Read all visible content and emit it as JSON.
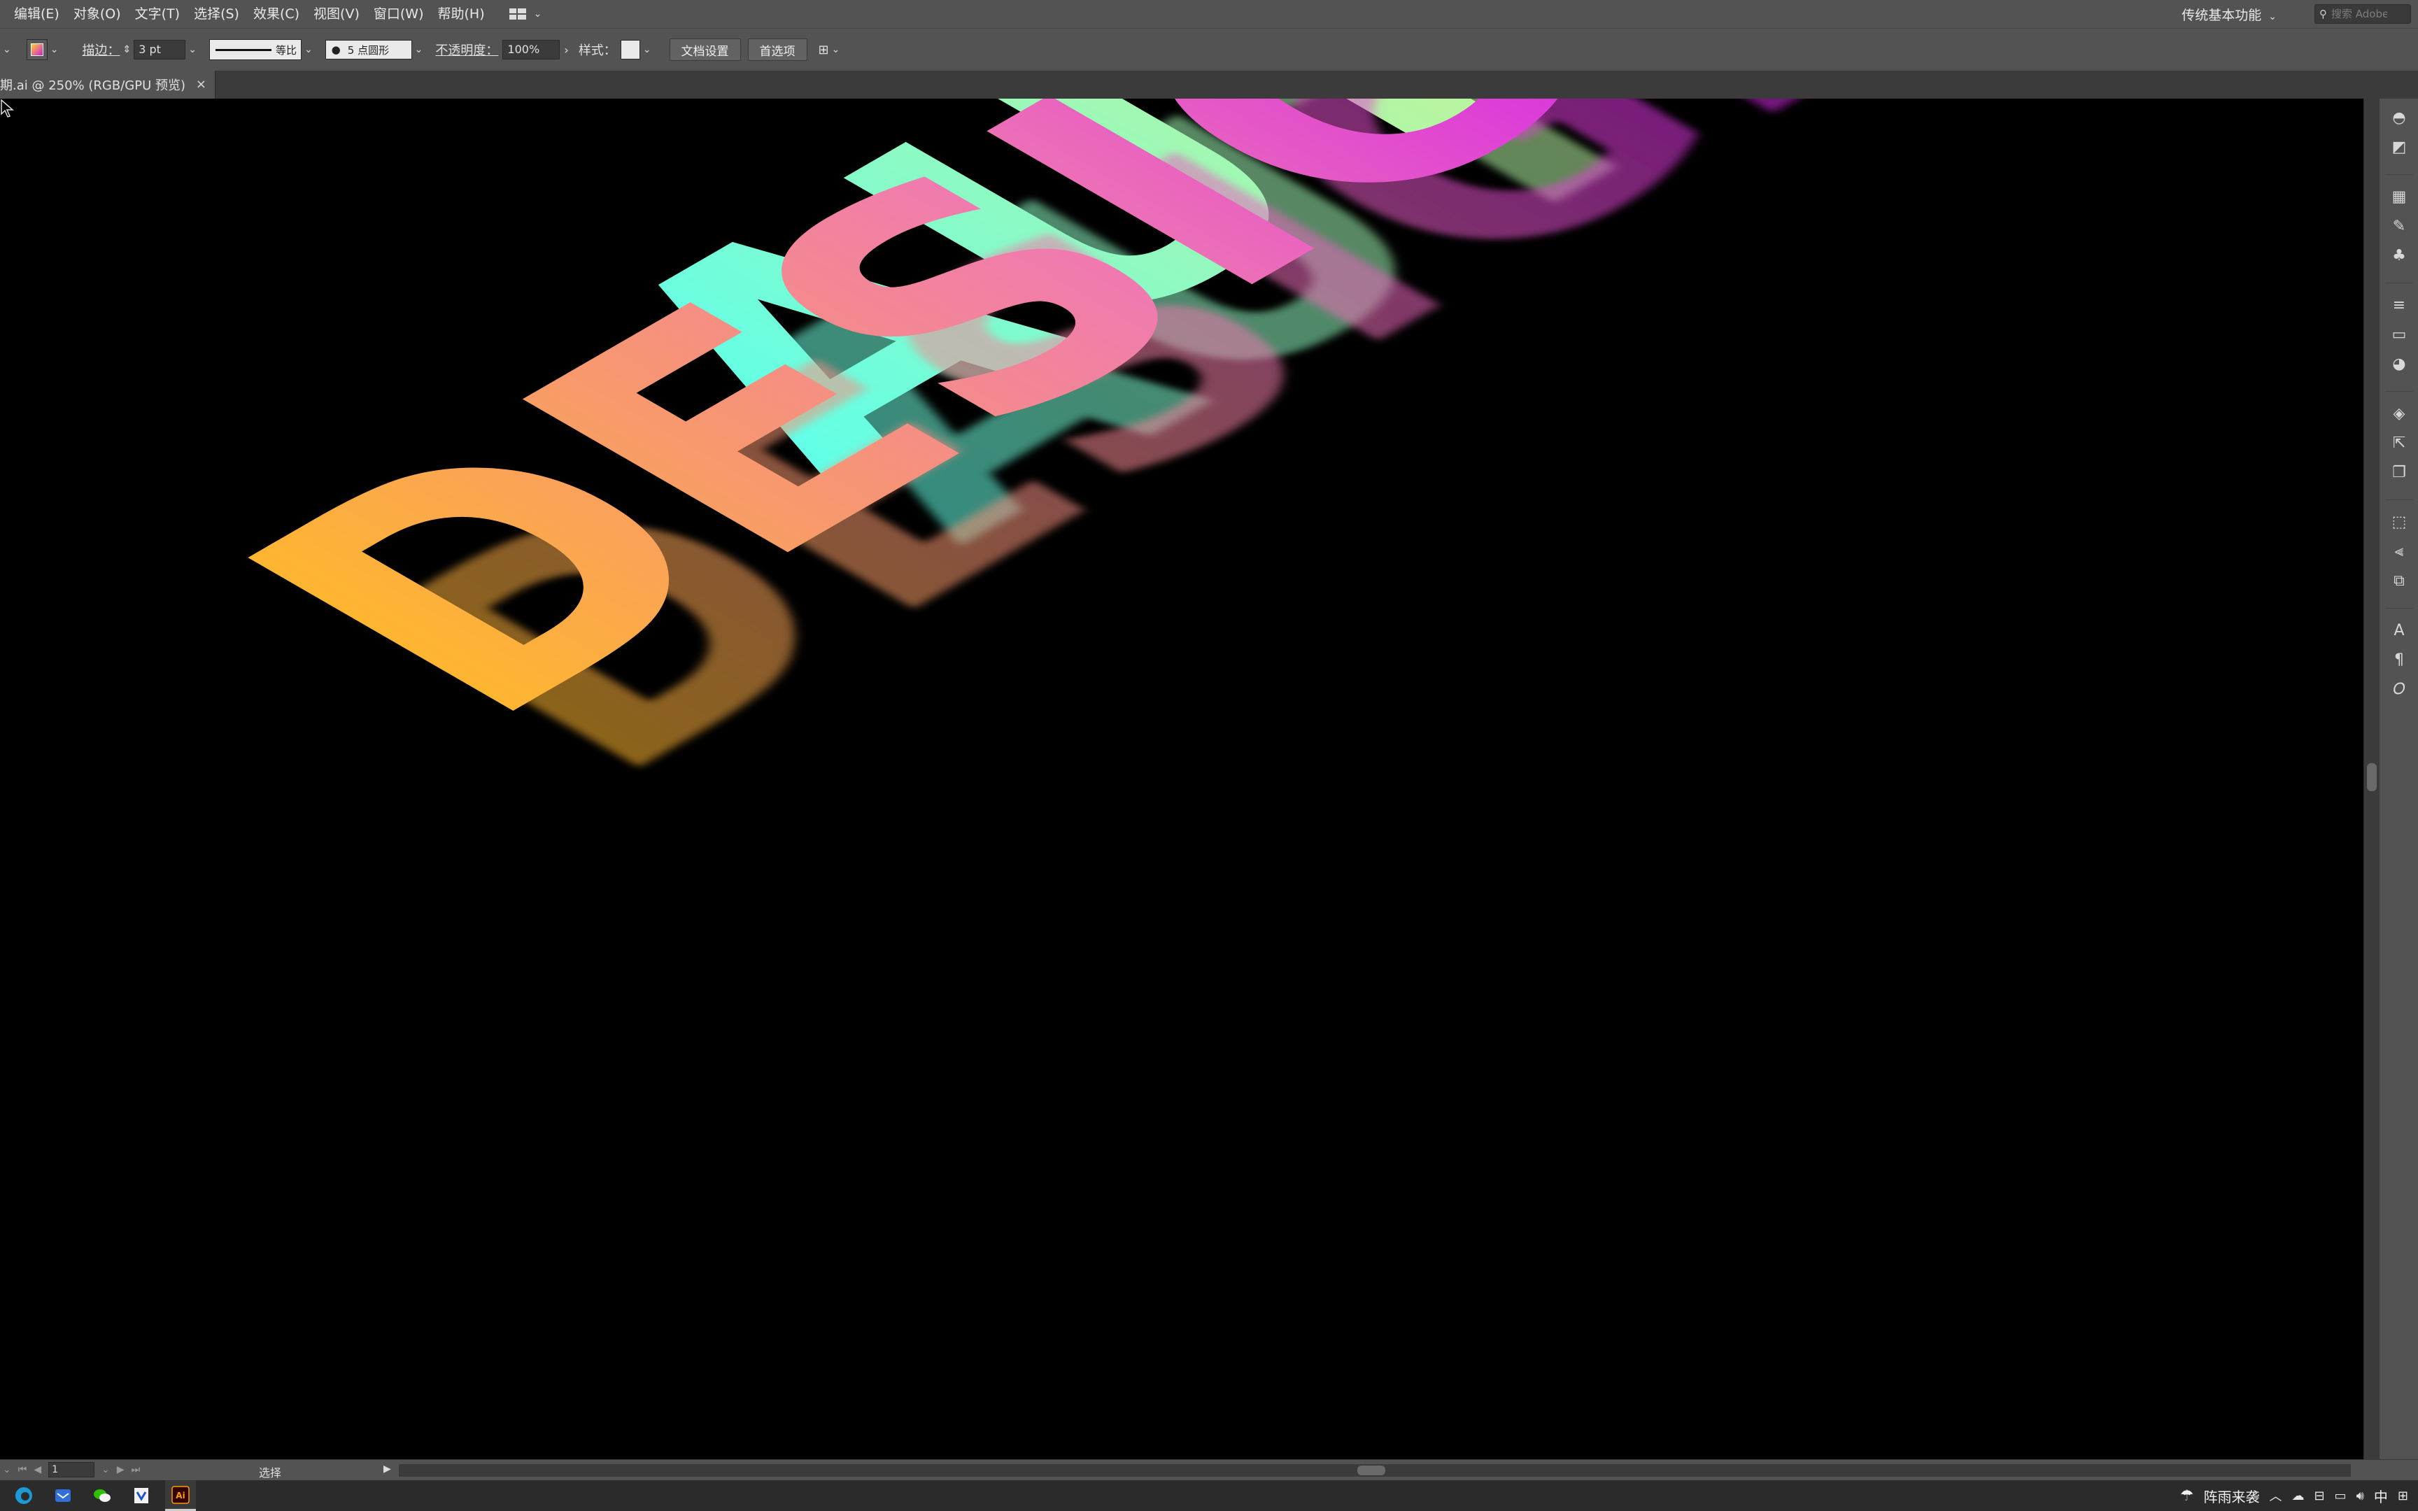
{
  "menubar": {
    "items": [
      "编辑(E)",
      "对象(O)",
      "文字(T)",
      "选择(S)",
      "效果(C)",
      "视图(V)",
      "窗口(W)",
      "帮助(H)"
    ],
    "workspace": "传统基本功能",
    "search_placeholder": "搜索 Adobe"
  },
  "controlbar": {
    "stroke_label": "描边：",
    "stroke_value": "3 pt",
    "profile_label": "等比",
    "brush_label": "5 点圆形",
    "opacity_label": "不透明度：",
    "opacity_value": "100%",
    "style_label": "样式：",
    "doc_setup_button": "文档设置",
    "preferences_button": "首选项"
  },
  "document": {
    "tab_title": "期.ai @ 250% (RGB/GPU 预览)",
    "close_glyph": "×"
  },
  "artwork": {
    "row1_text": "AUTOU",
    "row2_text": "DESIGN",
    "colors": {
      "row1_left": "#5fffe9",
      "row1_mid": "#b8f5a0",
      "row1_right": "#ffd23a",
      "row2_left": "#ffb82a",
      "row2_mid": "#f07ab0",
      "row2_right": "#c800ff",
      "background": "#000000"
    }
  },
  "statusbar": {
    "page_number": "1",
    "current_tool": "选择"
  },
  "taskbar": {
    "weather_text": "阵雨来袭",
    "ime_label": "中"
  }
}
